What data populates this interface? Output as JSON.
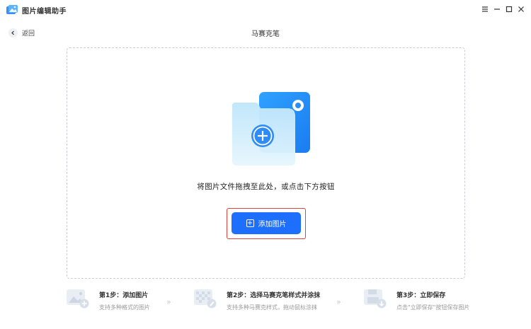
{
  "window": {
    "title": "图片编辑助手",
    "controls": [
      "menu-icon",
      "minimize-icon",
      "maximize-icon",
      "close-icon"
    ]
  },
  "nav": {
    "back_label": "返回",
    "page_title": "马赛克笔"
  },
  "drop_zone": {
    "hint": "将图片文件拖拽至此处，或点击下方按钮",
    "button_label": "添加图片",
    "icon": "add-image-folder-icon"
  },
  "steps": [
    {
      "title": "第1步：添加图片",
      "desc": "支持多种格式的图片",
      "icon": "add-picture-icon"
    },
    {
      "title": "第2步：选择马赛克笔样式并涂抹",
      "desc": "支持多种马赛克样式，拖动鼠标涂抹",
      "icon": "mosaic-brush-icon"
    },
    {
      "title": "第3步：立即保存",
      "desc": "点击\"立即保存\"按钮保存图片",
      "icon": "save-picture-icon"
    }
  ],
  "colors": {
    "accent": "#1f6fff",
    "highlight": "#e0443a",
    "dashed_border": "#c9cdd3",
    "muted_text": "#999999"
  }
}
